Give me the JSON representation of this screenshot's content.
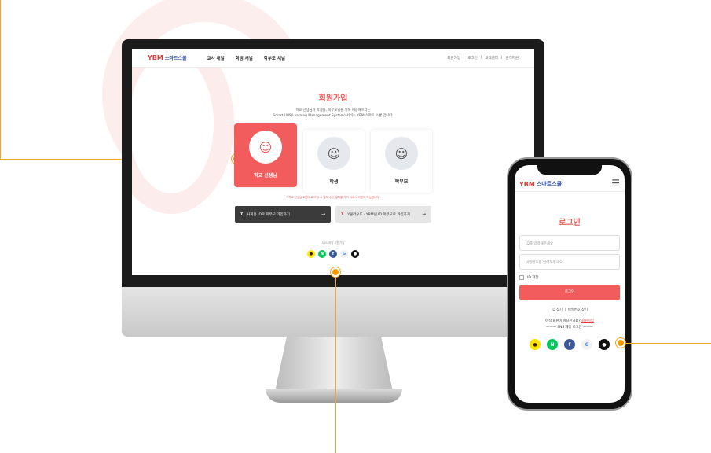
{
  "desktop": {
    "logo": {
      "mark": "YBM",
      "text": "스마트스쿨"
    },
    "nav": [
      "교사 채널",
      "학생 채널",
      "학부모 채널"
    ],
    "util": [
      "회원가입",
      "로그인",
      "고객센터",
      "원격지원"
    ],
    "title": "회원가입",
    "desc1": "학교 선생님과 학생들, 학부모님을 위해 제공해드리는",
    "desc2": "Smart LMS(Learning Management System) 서비스 YBM 스마트 스쿨 입니다.",
    "cards": [
      {
        "label": "학교 선생님"
      },
      {
        "label": "학생"
      },
      {
        "label": "학부모"
      }
    ],
    "note": "* 학교 선생님 회원으로 가입 시 별도 승인 절차를 거쳐 서비스 이용이 가능합니다.",
    "btn_dark": "사회용 ID로 학부모 가입하기",
    "btn_light": "Y클라우드 · YBM넷 ID 학부모로 가입하기",
    "arrow": "→",
    "sns_label": "SNS 계정 회원가입"
  },
  "mobile": {
    "logo": {
      "mark": "YBM",
      "text": "스마트스쿨"
    },
    "title": "로그인",
    "id_placeholder": "ID를 입력해주세요",
    "pw_placeholder": "비밀번호를 입력해주세요",
    "save_id": "ID 저장",
    "login_btn": "로그인",
    "find_id": "ID 찾기",
    "find_pw": "비밀번호 찾기",
    "join_q": "아직 회원이 아니신가요?",
    "join_link": "회원가입",
    "sns_label": "SNS 계정 로그인"
  },
  "sns": [
    {
      "name": "kakao",
      "glyph": "●",
      "color": "#fee500"
    },
    {
      "name": "naver",
      "glyph": "N",
      "color": "#03c75a"
    },
    {
      "name": "facebook",
      "glyph": "f",
      "color": "#3b5998"
    },
    {
      "name": "google",
      "glyph": "G",
      "color": "#f1f1f1"
    },
    {
      "name": "apple",
      "glyph": "●",
      "color": "#111111"
    }
  ],
  "accent": "#f25c5c"
}
